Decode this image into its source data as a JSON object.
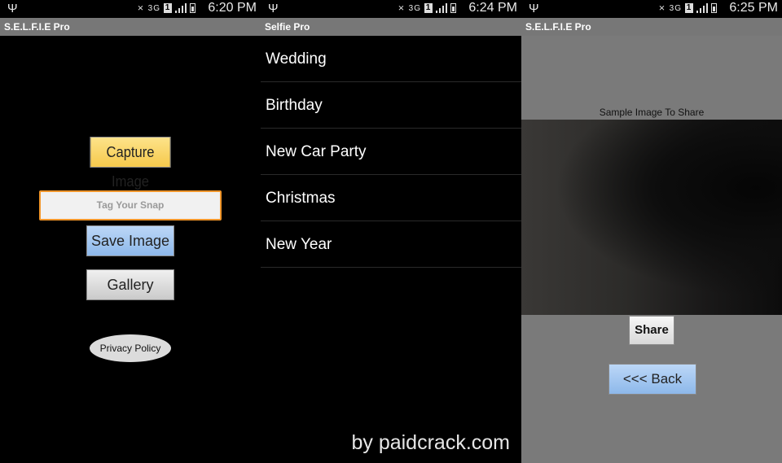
{
  "screens": [
    {
      "status": {
        "time": "6:20 PM",
        "network": "3G",
        "sim": "1"
      },
      "app_title": "S.E.L.F.I.E Pro",
      "capture_label": "Capture Image",
      "tag_placeholder": "Tag Your Snap",
      "save_label": "Save Image",
      "gallery_label": "Gallery",
      "privacy_label": "Privacy Policy"
    },
    {
      "status": {
        "time": "6:24 PM",
        "network": "3G",
        "sim": "1"
      },
      "app_title": "Selfie Pro",
      "items": [
        "Wedding",
        "Birthday",
        "New Car Party",
        "Christmas",
        "New Year"
      ]
    },
    {
      "status": {
        "time": "6:25 PM",
        "network": "3G",
        "sim": "1"
      },
      "app_title": "S.E.L.F.I.E Pro",
      "image_label": "Sample Image To Share",
      "share_label": "Share",
      "back_label": "<<< Back"
    }
  ],
  "watermark": "by paidcrack.com",
  "colors": {
    "input_border": "#f0952a",
    "capture_button": "#f6c94c",
    "save_button": "#8db8ea",
    "titlebar": "#777777"
  }
}
